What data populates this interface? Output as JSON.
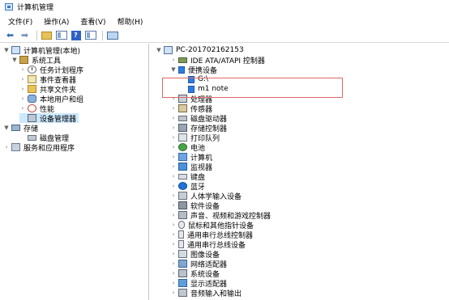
{
  "window": {
    "title": "计算机管理"
  },
  "menu": [
    "文件(F)",
    "操作(A)",
    "查看(V)",
    "帮助(H)"
  ],
  "toolbar": {
    "buttons": [
      {
        "name": "back-button",
        "icon": "back-arrow-icon"
      },
      {
        "name": "forward-button",
        "icon": "forward-arrow-icon"
      },
      {
        "name": "up-folder-button",
        "icon": "folder-icon"
      },
      {
        "name": "show-console-tree-button",
        "icon": "console-tree-icon"
      },
      {
        "name": "help-button",
        "icon": "help-icon"
      },
      {
        "name": "properties-button",
        "icon": "panel-icon"
      },
      {
        "name": "monitor-button",
        "icon": "monitor-icon"
      }
    ]
  },
  "left_tree": {
    "root": "计算机管理(本地)",
    "system_tools": "系统工具",
    "task_scheduler": "任务计划程序",
    "event_viewer": "事件查看器",
    "shared_folders": "共享文件夹",
    "local_users": "本地用户和组",
    "performance": "性能",
    "device_manager": "设备管理器",
    "storage": "存储",
    "disk_management": "磁盘管理",
    "services": "服务和应用程序"
  },
  "right_tree": {
    "computer": "PC-201702162153",
    "categories": [
      "IDE ATA/ATAPI 控制器",
      "便携设备",
      "G:\\",
      "m1 note",
      "处理器",
      "传感器",
      "磁盘驱动器",
      "存储控制器",
      "打印队列",
      "电池",
      "计算机",
      "监视器",
      "键盘",
      "蓝牙",
      "人体学输入设备",
      "软件设备",
      "声音、视频和游戏控制器",
      "鼠标和其他指针设备",
      "通用串行总线控制器",
      "通用串行总线设备",
      "图像设备",
      "网络适配器",
      "系统设备",
      "显示适配器",
      "音频输入和输出"
    ]
  },
  "highlight_color": "#e06666",
  "selection_color": "#cce8ff"
}
